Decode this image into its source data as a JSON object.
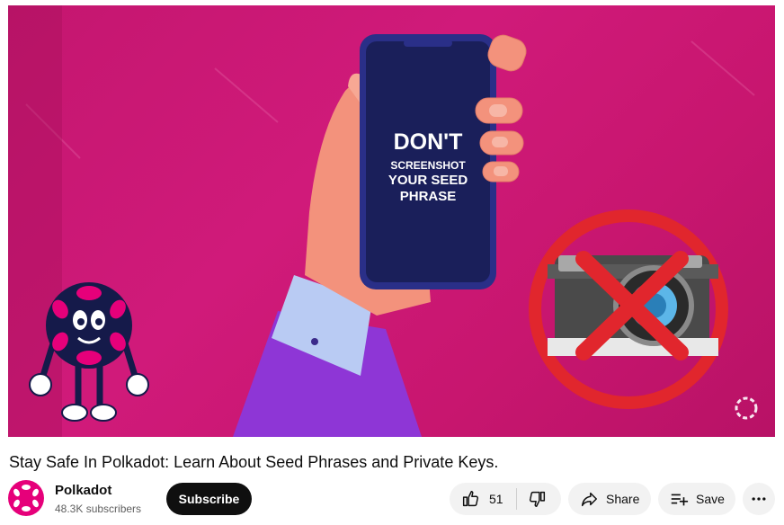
{
  "video": {
    "overlay_lines": [
      "DON'T",
      "SCREENSHOT",
      "YOUR SEED",
      "PHRASE"
    ],
    "title": "Stay Safe In Polkadot: Learn About Seed Phrases and Private Keys."
  },
  "channel": {
    "name": "Polkadot",
    "subscribers": "48.3K subscribers"
  },
  "actions": {
    "subscribe_label": "Subscribe",
    "like_count": "51",
    "share_label": "Share",
    "save_label": "Save"
  },
  "colors": {
    "brand": "#e6007a",
    "background": "#c8166f",
    "no_sign": "#e1262d"
  },
  "icons": [
    "like-icon",
    "dislike-icon",
    "share-icon",
    "save-icon",
    "more-icon",
    "polkadot-logo-icon"
  ]
}
